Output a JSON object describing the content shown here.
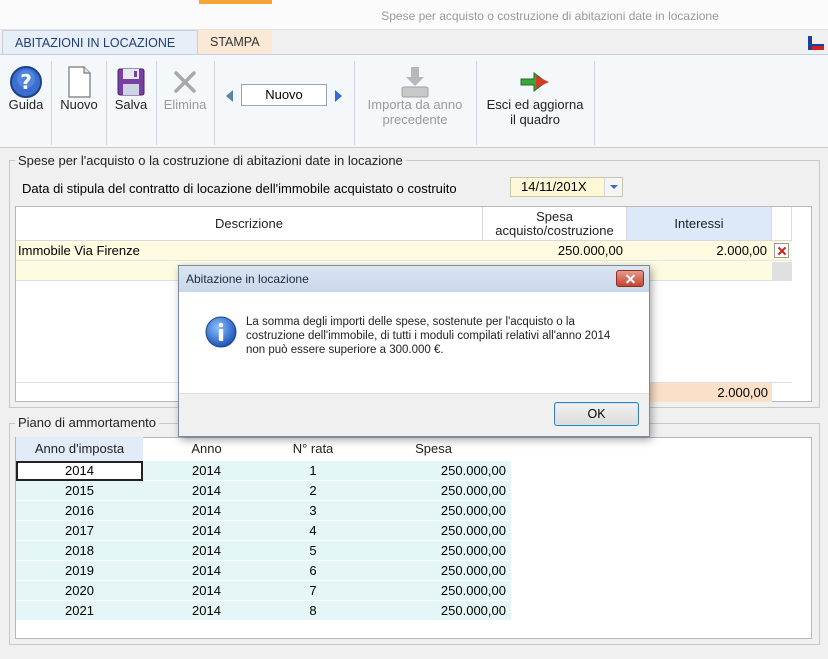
{
  "window": {
    "title": "Spese per acquisto o costruzione di abitazioni date in locazione"
  },
  "tabs": [
    {
      "label": "ABITAZIONI IN LOCAZIONE"
    },
    {
      "label": "STAMPA"
    }
  ],
  "toolbar": {
    "guida": "Guida",
    "nuovo": "Nuovo",
    "salva": "Salva",
    "elimina": "Elimina",
    "nav_value": "Nuovo",
    "importa_line1": "Importa da anno",
    "importa_line2": "precedente",
    "esci_line1": "Esci ed aggiorna",
    "esci_line2": "il quadro"
  },
  "section1": {
    "legend": "Spese per l'acquisto o la costruzione di abitazioni date in locazione",
    "date_label": "Data di stipula del contratto di locazione dell'immobile acquistato o costruito",
    "date_value": "14/11/201X"
  },
  "expense_table": {
    "headers": {
      "descrizione": "Descrizione",
      "spesa_line1": "Spesa",
      "spesa_line2": "acquisto/costruzione",
      "interessi": "Interessi"
    },
    "rows": [
      {
        "descrizione": "Immobile Via Firenze",
        "spesa": "250.000,00",
        "interessi": "2.000,00"
      }
    ],
    "total_interessi": "2.000,00"
  },
  "section2": {
    "legend": "Piano di ammortamento"
  },
  "amort_table": {
    "headers": {
      "anno_imposta": "Anno d'imposta",
      "anno": "Anno",
      "rata": "N° rata",
      "spesa": "Spesa"
    },
    "rows": [
      {
        "anno_imposta": "2014",
        "anno": "2014",
        "rata": "1",
        "spesa": "250.000,00"
      },
      {
        "anno_imposta": "2015",
        "anno": "2014",
        "rata": "2",
        "spesa": "250.000,00"
      },
      {
        "anno_imposta": "2016",
        "anno": "2014",
        "rata": "3",
        "spesa": "250.000,00"
      },
      {
        "anno_imposta": "2017",
        "anno": "2014",
        "rata": "4",
        "spesa": "250.000,00"
      },
      {
        "anno_imposta": "2018",
        "anno": "2014",
        "rata": "5",
        "spesa": "250.000,00"
      },
      {
        "anno_imposta": "2019",
        "anno": "2014",
        "rata": "6",
        "spesa": "250.000,00"
      },
      {
        "anno_imposta": "2020",
        "anno": "2014",
        "rata": "7",
        "spesa": "250.000,00"
      },
      {
        "anno_imposta": "2021",
        "anno": "2014",
        "rata": "8",
        "spesa": "250.000,00"
      }
    ]
  },
  "dialog": {
    "title": "Abitazione in locazione",
    "message": "La somma degli importi delle spese, sostenute per l'acquisto o la costruzione dell'immobile, di tutti i moduli compilati relativi all'anno 2014 non può essere superiore a 300.000 €.",
    "ok": "OK"
  },
  "colors": {
    "accent": "#f7a335",
    "row_highlight": "#fffbe0",
    "amort_row": "#e4f6f6",
    "interessi_header": "#dde8f8",
    "total_cell": "#fbe0c8"
  }
}
